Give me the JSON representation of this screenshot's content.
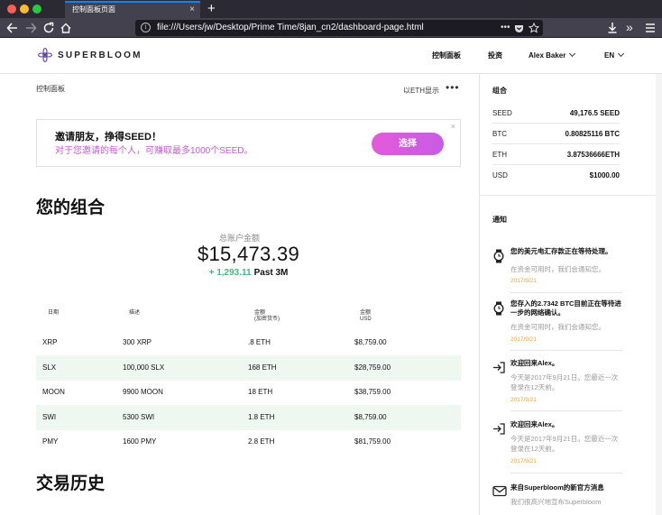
{
  "browser": {
    "tab_title": "控制面板页面",
    "tab_close": "×",
    "new_tab": "+",
    "url": "file:///Users/jw/Desktop/Prime Time/8jan_cn2/dashboard-page.html",
    "info_glyph": "i",
    "icons": [
      "back-arrow-icon",
      "forward-arrow-icon",
      "reload-icon",
      "home-icon",
      "page-actions-icon",
      "pocket-icon",
      "bookmark-star-icon",
      "download-icon",
      "overflow-icon",
      "menu-icon"
    ]
  },
  "header": {
    "brand": "SUPERBLOOM",
    "nav_dashboard": "控制面板",
    "nav_invest": "投资",
    "user_name": "Alex Baker",
    "language": "EN"
  },
  "main": {
    "breadcrumb": "控制面板",
    "eth_toggle": "以ETH显示",
    "more": "•••",
    "invite": {
      "title": "邀请朋友，挣得SEED！",
      "subtitle": "对于您邀请的每个人，可赚取最多1000个SEED。",
      "button": "选择",
      "close": "×"
    },
    "portfolio_heading": "您的组合",
    "total_label": "总账户金额",
    "total_value": "$15,473.39",
    "change_value": "+ 1,293.11",
    "change_period": "Past 3M",
    "table": {
      "headers": {
        "date": "日期",
        "desc": "描述",
        "amount_crypto_1": "金额",
        "amount_crypto_2": "(加密货币)",
        "amount_usd_1": "金额",
        "amount_usd_2": "USD"
      },
      "rows": [
        {
          "symbol": "XRP",
          "desc": "300 XRP",
          "crypto": ".8 ETH",
          "usd": "$8,759.00"
        },
        {
          "symbol": "SLX",
          "desc": "100,000 SLX",
          "crypto": "168 ETH",
          "usd": "$28,759.00"
        },
        {
          "symbol": "MOON",
          "desc": "9900 MOON",
          "crypto": "18 ETH",
          "usd": "$38,759.00"
        },
        {
          "symbol": "SWI",
          "desc": "5300 SWI",
          "crypto": "1.8 ETH",
          "usd": "$8,759.00"
        },
        {
          "symbol": "PMY",
          "desc": "1600 PMY",
          "crypto": "2.8 ETH",
          "usd": "$81,759.00"
        }
      ]
    },
    "history_heading": "交易历史"
  },
  "sidebar": {
    "holdings_heading": "组合",
    "holdings": [
      {
        "symbol": "SEED",
        "value": "49,176.5 SEED"
      },
      {
        "symbol": "BTC",
        "value": "0.80825116 BTC"
      },
      {
        "symbol": "ETH",
        "value": "3.87536666ETH"
      },
      {
        "symbol": "USD",
        "value": "$1000.00"
      }
    ],
    "notifications_heading": "通知",
    "notifications": [
      {
        "icon": "watch-icon",
        "title": "您的美元电汇存款正在等待处理。",
        "body": "在资金可用时，我们会通知您。",
        "date": "2017/9/21"
      },
      {
        "icon": "watch-icon",
        "title": "您存入的2.7342 BTC目前正在等待进一步的网络确认。",
        "body": "在资金可用时，我们会通知您。",
        "date": "2017/9/21"
      },
      {
        "icon": "sign-in-icon",
        "title": "欢迎回来Alex。",
        "body": "今天是2017年9月21日。您最近一次登录在12天前。",
        "date": "2017/9/21"
      },
      {
        "icon": "sign-in-icon",
        "title": "欢迎回来Alex。",
        "body": "今天是2017年9月21日。您最近一次登录在12天前。",
        "date": "2017/9/21"
      },
      {
        "icon": "mail-icon",
        "title": "来自Superbloom的新官方消息",
        "body": "我们很高兴地宣布Superbloom"
      }
    ]
  }
}
